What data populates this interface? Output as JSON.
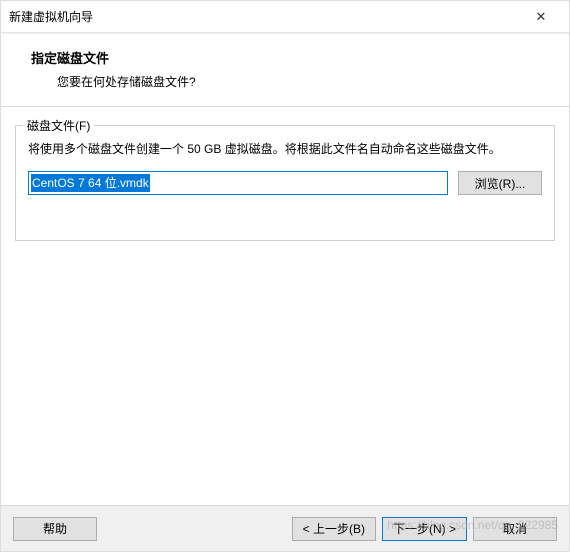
{
  "titlebar": {
    "title": "新建虚拟机向导",
    "close_icon": "✕"
  },
  "header": {
    "title": "指定磁盘文件",
    "subtitle": "您要在何处存储磁盘文件?"
  },
  "group": {
    "legend": "磁盘文件(F)",
    "description": "将使用多个磁盘文件创建一个 50 GB 虚拟磁盘。将根据此文件名自动命名这些磁盘文件。",
    "file_value": "CentOS 7 64 位.vmdk",
    "browse_label": "浏览(R)..."
  },
  "footer": {
    "help_label": "帮助",
    "back_label": "< 上一步(B)",
    "next_label": "下一步(N) >",
    "cancel_label": "取消"
  },
  "watermark": "https://blog.csdn.net/qq_222985"
}
